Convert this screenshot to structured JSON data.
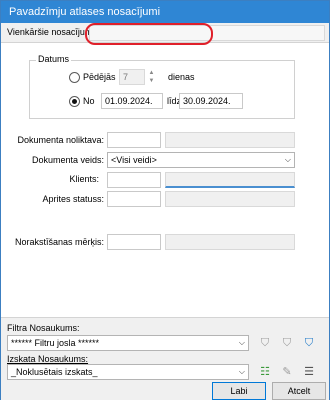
{
  "window": {
    "title": "Pavadzīmju atlases nosacījumi"
  },
  "top_field": {
    "label": "Vienkāršie nosacījumi",
    "value": ""
  },
  "datums": {
    "legend": "Datums",
    "last_days_label": "Pēdējās",
    "last_days_value": "7",
    "days_unit": "dienas",
    "from_label": "No",
    "from_value": "01.09.2024.",
    "to_label": "līdz",
    "to_value": "30.09.2024.",
    "selected": "No"
  },
  "filters": {
    "noliktava_label": "Dokumenta noliktava:",
    "veids_label": "Dokumenta veids:",
    "veids_value": "<Visi veidi>",
    "klients_label": "Klients:",
    "statuss_label": "Aprites statuss:",
    "merkis_label": "Norakstīšanas mērķis:"
  },
  "bottom": {
    "filter_name_label": "Filtra Nosaukums:",
    "filter_name_value": "****** Filtru josla ******",
    "view_name_label": "Izskata Nosaukums:",
    "view_name_value": "_Noklusētais izskats_"
  },
  "buttons": {
    "ok": "Labi",
    "cancel": "Atcelt"
  },
  "icons": {
    "filter1": "filter-icon",
    "filter2": "filter-clear-icon",
    "filter3": "filter-active-icon",
    "view_add": "add-view-icon",
    "view_edit": "edit-view-icon",
    "view_list": "view-list-icon"
  },
  "colors": {
    "title_bg": "#2f86d4",
    "highlight": "#e0202a",
    "accent": "#0078d7"
  }
}
